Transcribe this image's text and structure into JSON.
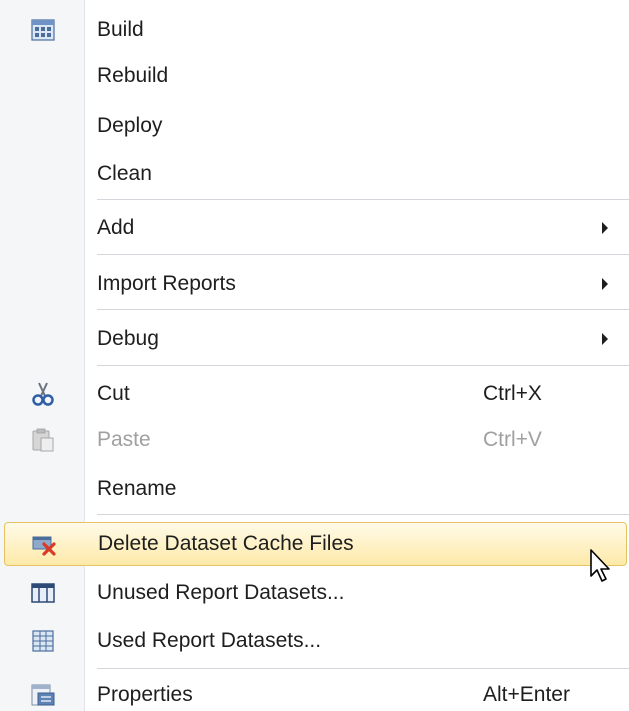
{
  "menu": {
    "items": [
      {
        "label": "Build",
        "icon": "build-icon"
      },
      {
        "label": "Rebuild"
      },
      {
        "label": "Deploy"
      },
      {
        "label": "Clean"
      },
      {
        "label": "Add",
        "submenu": true
      },
      {
        "label": "Import Reports",
        "submenu": true
      },
      {
        "label": "Debug",
        "submenu": true
      },
      {
        "label": "Cut",
        "shortcut": "Ctrl+X",
        "icon": "scissors-icon"
      },
      {
        "label": "Paste",
        "shortcut": "Ctrl+V",
        "icon": "paste-icon",
        "disabled": true
      },
      {
        "label": "Rename"
      },
      {
        "label": "Delete Dataset Cache Files",
        "icon": "delete-cache-icon",
        "highlighted": true
      },
      {
        "label": "Unused Report Datasets...",
        "icon": "unused-datasets-icon"
      },
      {
        "label": "Used Report Datasets...",
        "icon": "used-datasets-icon"
      },
      {
        "label": "Properties",
        "shortcut": "Alt+Enter",
        "icon": "properties-icon"
      }
    ]
  },
  "colors": {
    "gutter": "#f4f6f8",
    "separator": "#d4d6dc",
    "highlight_border": "#e5c365",
    "highlight_fill": "#fde9a8",
    "text": "#1e1e1e",
    "disabled_text": "#a0a0a0"
  }
}
